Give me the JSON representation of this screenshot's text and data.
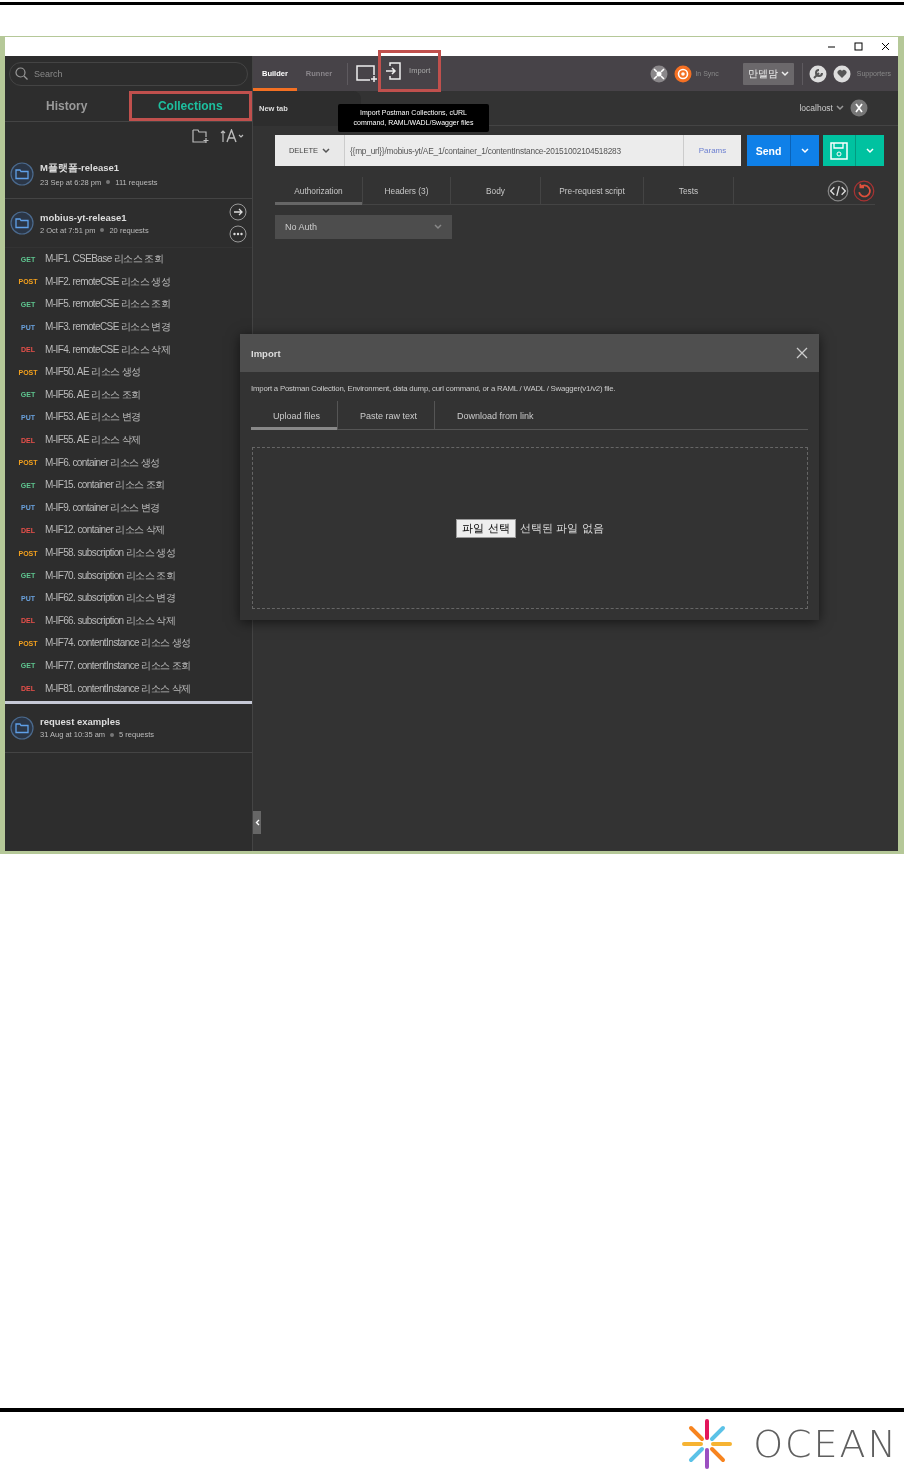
{
  "sidebar": {
    "search": {
      "placeholder": "Search"
    },
    "tabs": [
      {
        "label": "History",
        "selected": false,
        "highlight": false
      },
      {
        "label": "Collections",
        "selected": true,
        "highlight": true
      }
    ],
    "collections": [
      {
        "name": "M플랫폼-release1",
        "date": "23 Sep at 6:28 pm",
        "count": "111 requests",
        "expanded": false
      },
      {
        "name": "mobius-yt-release1",
        "date": "2 Oct at 7:51 pm",
        "count": "20 requests",
        "expanded": true,
        "requests": [
          {
            "method": "GET",
            "color": "#5fc690",
            "name": "M-IF1. CSEBase 리소스 조회"
          },
          {
            "method": "POST",
            "color": "#f4a11d",
            "name": "M-IF2. remoteCSE 리소스 생성"
          },
          {
            "method": "GET",
            "color": "#5fc690",
            "name": "M-IF5. remoteCSE 리소스 조회"
          },
          {
            "method": "PUT",
            "color": "#6aa2de",
            "name": "M-IF3. remoteCSE 리소스 변경"
          },
          {
            "method": "DEL",
            "color": "#e8504a",
            "name": "M-IF4. remoteCSE 리소스 삭제"
          },
          {
            "method": "POST",
            "color": "#f4a11d",
            "name": "M-IF50. AE 리소스 생성"
          },
          {
            "method": "GET",
            "color": "#5fc690",
            "name": "M-IF56. AE 리소스 조회"
          },
          {
            "method": "PUT",
            "color": "#6aa2de",
            "name": "M-IF53. AE 리소스 변경"
          },
          {
            "method": "DEL",
            "color": "#e8504a",
            "name": "M-IF55. AE 리소스 삭제"
          },
          {
            "method": "POST",
            "color": "#f4a11d",
            "name": "M-IF6. container 리소스 생성"
          },
          {
            "method": "GET",
            "color": "#5fc690",
            "name": "M-IF15. container 리소스 조회"
          },
          {
            "method": "PUT",
            "color": "#6aa2de",
            "name": "M-IF9. container 리소스 변경"
          },
          {
            "method": "DEL",
            "color": "#e8504a",
            "name": "M-IF12. container 리소스 삭제"
          },
          {
            "method": "POST",
            "color": "#f4a11d",
            "name": "M-IF58. subscription 리소스 생성"
          },
          {
            "method": "GET",
            "color": "#5fc690",
            "name": "M-IF70. subscription 리소스 조회"
          },
          {
            "method": "PUT",
            "color": "#6aa2de",
            "name": "M-IF62. subscription 리소스 변경"
          },
          {
            "method": "DEL",
            "color": "#e8504a",
            "name": "M-IF66. subscription 리소스 삭제"
          },
          {
            "method": "POST",
            "color": "#f4a11d",
            "name": "M-IF74. contentInstance 리소스 생성"
          },
          {
            "method": "GET",
            "color": "#5fc690",
            "name": "M-IF77. contentInstance 리소스 조회"
          },
          {
            "method": "DEL",
            "color": "#e8504a",
            "name": "M-IF81. contentInstance 리소스 삭제"
          }
        ]
      },
      {
        "name": "request examples",
        "date": "31 Aug at 10:35 am",
        "count": "5 requests",
        "expanded": false
      }
    ]
  },
  "toolbar": {
    "tabs": [
      {
        "label": "Builder",
        "selected": true
      },
      {
        "label": "Runner",
        "selected": false
      }
    ],
    "import": {
      "label": "Import",
      "highlight": true
    },
    "tooltip": "Import Postman Collections, cURL\ncommand, RAML/WADL/Swagger files",
    "sync": "In Sync",
    "user": "만델맘",
    "supporters": "Supporters"
  },
  "request_tabs": [
    {
      "label": "New tab",
      "selected": true
    }
  ],
  "environment": "localhost",
  "request": {
    "method": "DELETE",
    "url": "{{mp_url}}/mobius-yt/AE_1/container_1/contentInstance-20151002104518283",
    "params": "Params",
    "send": "Send"
  },
  "request_sections": [
    {
      "label": "Authorization",
      "selected": true
    },
    {
      "label": "Headers (3)",
      "selected": false
    },
    {
      "label": "Body",
      "selected": false
    },
    {
      "label": "Pre-request script",
      "selected": false
    },
    {
      "label": "Tests",
      "selected": false
    }
  ],
  "auth": {
    "value": "No Auth"
  },
  "import_dialog": {
    "title": "Import",
    "description": "Import a Postman Collection, Environment, data dump, curl command, or a RAML / WADL / Swagger(v1/v2) file.",
    "tabs": [
      {
        "label": "Upload files",
        "selected": true
      },
      {
        "label": "Paste raw text",
        "selected": false
      },
      {
        "label": "Download from link",
        "selected": false
      }
    ],
    "choose_file": "파일 선택",
    "no_file": "선택된 파일 없음"
  },
  "logo": {
    "text": "OCEAN"
  }
}
